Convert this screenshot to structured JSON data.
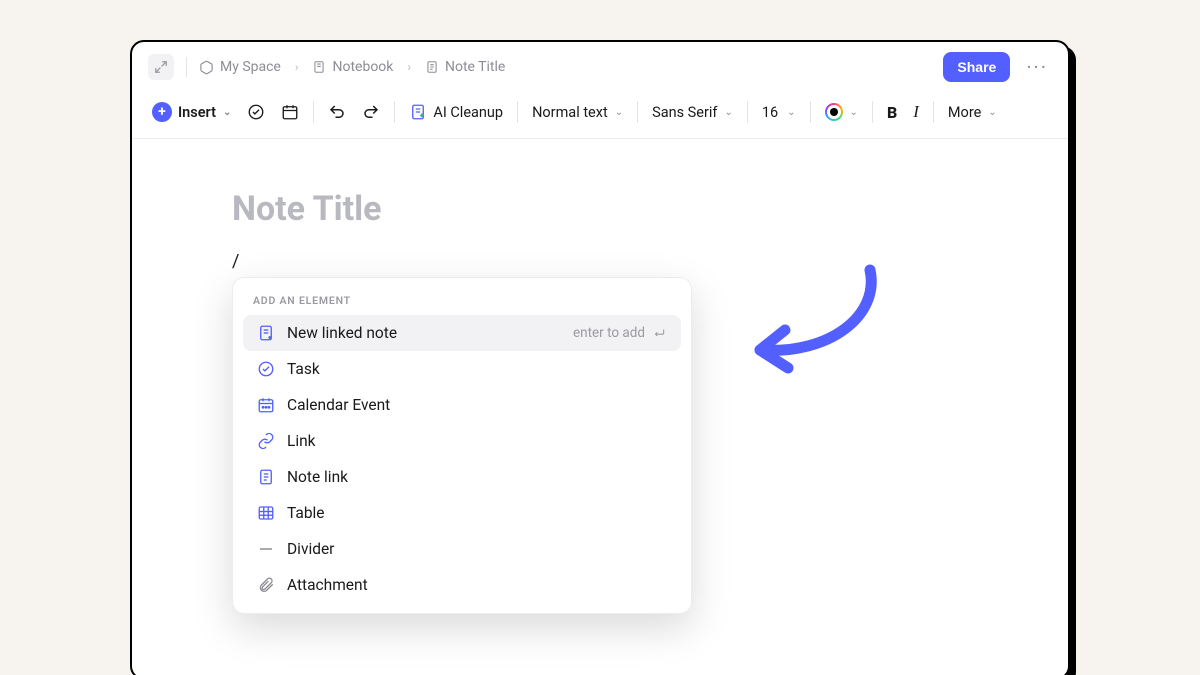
{
  "breadcrumb": {
    "space": "My Space",
    "notebook": "Notebook",
    "note": "Note Title"
  },
  "header": {
    "share_label": "Share"
  },
  "toolbar": {
    "insert_label": "Insert",
    "ai_cleanup_label": "AI Cleanup",
    "text_style_label": "Normal text",
    "font_family_label": "Sans Serif",
    "font_size": "16",
    "more_label": "More"
  },
  "editor": {
    "title_placeholder": "Note Title",
    "slash_text": "/"
  },
  "popup": {
    "heading": "ADD AN ELEMENT",
    "hint": "enter to add",
    "items": [
      {
        "label": "New linked note"
      },
      {
        "label": "Task"
      },
      {
        "label": "Calendar Event"
      },
      {
        "label": "Link"
      },
      {
        "label": "Note link"
      },
      {
        "label": "Table"
      },
      {
        "label": "Divider"
      },
      {
        "label": "Attachment"
      }
    ]
  }
}
